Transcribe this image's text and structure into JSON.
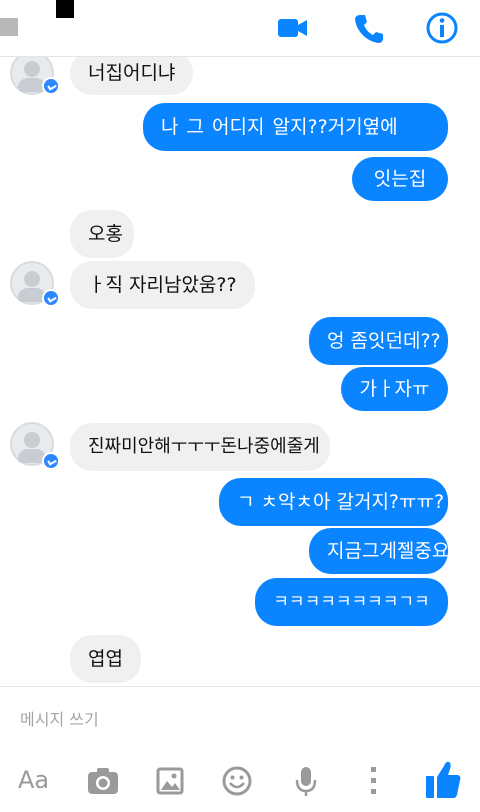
{
  "header": {
    "icons": [
      "back-icon",
      "video-call-icon",
      "phone-icon",
      "info-icon"
    ],
    "accent_color": "#0a84ff"
  },
  "messages": [
    {
      "side": "in",
      "text": "너집어디냐"
    },
    {
      "side": "out",
      "text": "나 그 어디지 알지??거기옆에"
    },
    {
      "side": "out",
      "text": "잇는집"
    },
    {
      "side": "in",
      "text": "오홍"
    },
    {
      "side": "in",
      "text": "ㅏ직 자리남았움??"
    },
    {
      "side": "out",
      "text": "엉 좀잇던데??"
    },
    {
      "side": "out",
      "text": "가ㅏ자ㅠ"
    },
    {
      "side": "in",
      "text": "진짜미안해ㅜㅜㅜ돈나중에줄게"
    },
    {
      "side": "out",
      "text": "ㄱ ㅊ악ㅊ아 갈거지?ㅠㅠ?"
    },
    {
      "side": "out",
      "text": "지금그게젤중요"
    },
    {
      "side": "out",
      "text": "ㅋㅋㅋㅋㅋㅋㅋㅋㄱㅋ"
    },
    {
      "side": "in",
      "text": "엽엽"
    }
  ],
  "composer": {
    "placeholder": "메시지 쓰기"
  },
  "toolbar": {
    "text_button_label": "Aa",
    "icons": [
      "text-format-icon",
      "camera-icon",
      "image-icon",
      "emoji-icon",
      "microphone-icon",
      "more-icon",
      "thumbs-up-icon"
    ]
  }
}
